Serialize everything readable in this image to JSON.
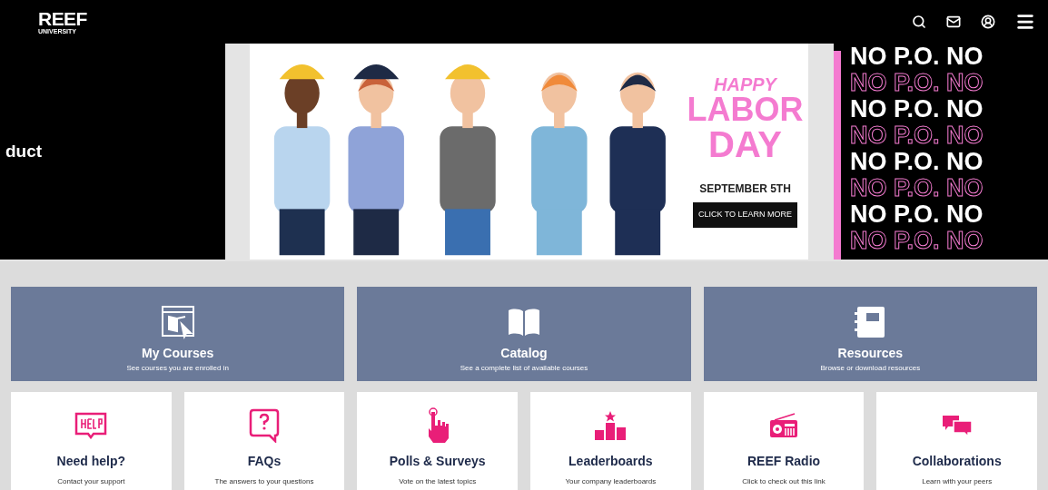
{
  "header": {
    "logo": "REEF",
    "logo_sub": "UNIVERSITY"
  },
  "carousel": {
    "prev_slide_text": "duct",
    "banner": {
      "line_1": "HAPPY",
      "line_2": "LABOR",
      "line_3": "DAY",
      "date": "SEPTEMBER 5TH",
      "button": "CLICK TO LEARN MORE"
    },
    "next_slide_rows": [
      {
        "text": "NO P.O. NO",
        "kind": "solid"
      },
      {
        "text": "NO P.O. NO",
        "kind": "outline"
      },
      {
        "text": "NO P.O. NO",
        "kind": "solid"
      },
      {
        "text": "NO P.O. NO",
        "kind": "outline"
      },
      {
        "text": "NO P.O. NO",
        "kind": "solid"
      },
      {
        "text": "NO P.O. NO",
        "kind": "outline"
      },
      {
        "text": "NO P.O. NO",
        "kind": "solid"
      },
      {
        "text": "NO P.O. NO",
        "kind": "outline"
      }
    ]
  },
  "feature_tiles": [
    {
      "title": "My Courses",
      "subtitle": "See courses you are enrolled in",
      "kind": "courses"
    },
    {
      "title": "Catalog",
      "subtitle": "See a complete list of available courses",
      "kind": "catalog"
    },
    {
      "title": "Resources",
      "subtitle": "Browse or download resources",
      "kind": "resources"
    }
  ],
  "quick_links": [
    {
      "title": "Need help?",
      "subtitle": "Contact your support",
      "kind": "help"
    },
    {
      "title": "FAQs",
      "subtitle": "The answers to your questions",
      "kind": "faq"
    },
    {
      "title": "Polls & Surveys",
      "subtitle": "Vote on the latest topics",
      "kind": "poll"
    },
    {
      "title": "Leaderboards",
      "subtitle": "Your company leaderboards",
      "kind": "leaderboard"
    },
    {
      "title": "REEF Radio",
      "subtitle": "Click to check out this link",
      "kind": "radio"
    },
    {
      "title": "Collaborations",
      "subtitle": "Learn with your peers",
      "kind": "chat"
    }
  ]
}
